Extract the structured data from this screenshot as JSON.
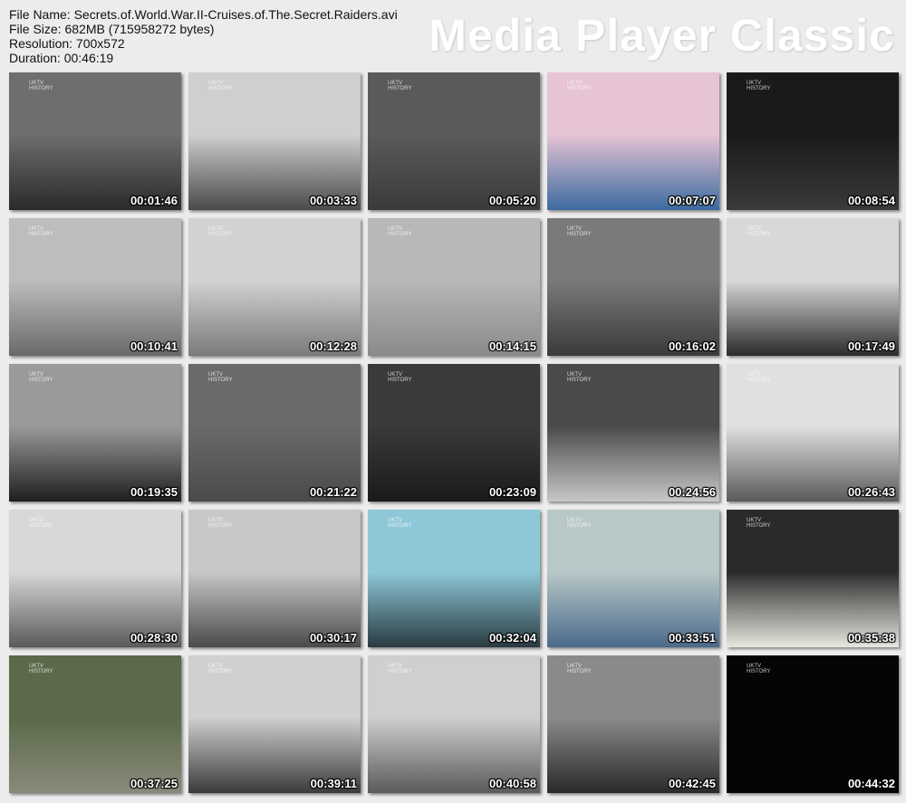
{
  "info": {
    "file_name": "File Name: Secrets.of.World.War.II-Cruises.of.The.Secret.Raiders.avi",
    "file_size": "File Size: 682MB (715958272 bytes)",
    "resolution": "Resolution: 700x572",
    "duration": "Duration: 00:46:19"
  },
  "logo": "Media Player Classic",
  "watermark": [
    "UKTV",
    "HISTORY"
  ],
  "thumbnails": [
    {
      "time": "00:01:46",
      "colors": [
        "#6e6e6e",
        "#2a2a2a"
      ]
    },
    {
      "time": "00:03:33",
      "colors": [
        "#cfcfcf",
        "#4a4a4a"
      ]
    },
    {
      "time": "00:05:20",
      "colors": [
        "#5a5a5a",
        "#3a3a3a"
      ]
    },
    {
      "time": "00:07:07",
      "colors": [
        "#e6c4d4",
        "#3d6aa0"
      ]
    },
    {
      "time": "00:08:54",
      "colors": [
        "#1a1a1a",
        "#3a3a3a"
      ]
    },
    {
      "time": "00:10:41",
      "colors": [
        "#bdbdbd",
        "#6a6a6a"
      ]
    },
    {
      "time": "00:12:28",
      "colors": [
        "#d2d2d2",
        "#7a7a7a"
      ]
    },
    {
      "time": "00:14:15",
      "colors": [
        "#b8b8b8",
        "#8a8a8a"
      ]
    },
    {
      "time": "00:16:02",
      "colors": [
        "#7a7a7a",
        "#3a3a3a"
      ]
    },
    {
      "time": "00:17:49",
      "colors": [
        "#d8d8d8",
        "#2a2a2a"
      ]
    },
    {
      "time": "00:19:35",
      "colors": [
        "#9a9a9a",
        "#1e1e1e"
      ]
    },
    {
      "time": "00:21:22",
      "colors": [
        "#6a6a6a",
        "#4a4a4a"
      ]
    },
    {
      "time": "00:23:09",
      "colors": [
        "#3a3a3a",
        "#1a1a1a"
      ]
    },
    {
      "time": "00:24:56",
      "colors": [
        "#4a4a4a",
        "#c8c8c8"
      ]
    },
    {
      "time": "00:26:43",
      "colors": [
        "#e0e0e0",
        "#5a5a5a"
      ]
    },
    {
      "time": "00:28:30",
      "colors": [
        "#d8d8d8",
        "#5a5a5a"
      ]
    },
    {
      "time": "00:30:17",
      "colors": [
        "#c8c8c8",
        "#4a4a4a"
      ]
    },
    {
      "time": "00:32:04",
      "colors": [
        "#8ec8d8",
        "#2a3a40"
      ]
    },
    {
      "time": "00:33:51",
      "colors": [
        "#b8c8c8",
        "#4a6a8a"
      ]
    },
    {
      "time": "00:35:38",
      "colors": [
        "#2a2a2a",
        "#e8e8e0"
      ]
    },
    {
      "time": "00:37:25",
      "colors": [
        "#5a6a4a",
        "#8a8a7a"
      ]
    },
    {
      "time": "00:39:11",
      "colors": [
        "#d0d0d0",
        "#3a3a3a"
      ]
    },
    {
      "time": "00:40:58",
      "colors": [
        "#cfcfcf",
        "#5a5a5a"
      ]
    },
    {
      "time": "00:42:45",
      "colors": [
        "#8a8a8a",
        "#2a2a2a"
      ]
    },
    {
      "time": "00:44:32",
      "colors": [
        "#050505",
        "#050505"
      ]
    }
  ]
}
